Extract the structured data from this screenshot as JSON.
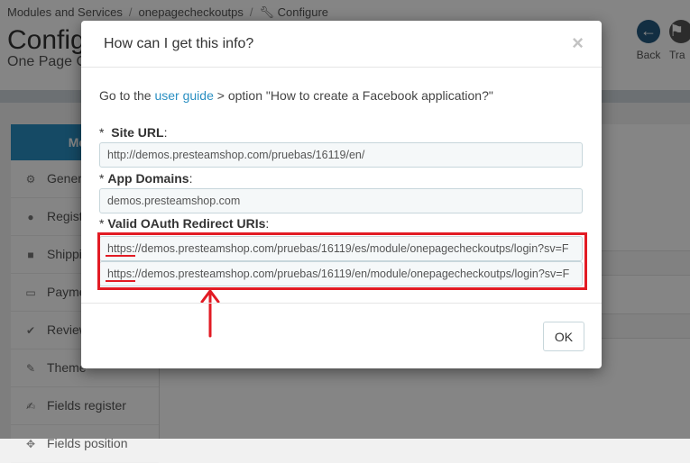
{
  "breadcrumb": [
    "Modules and Services",
    "onepagecheckoutps",
    "Configure"
  ],
  "page": {
    "title": "Configure",
    "subtitle": "One Page Checkout PS"
  },
  "toolbar": {
    "back_label": "Back",
    "translate_label": "Tra"
  },
  "sidebar": {
    "menu_label": "Menu",
    "items": [
      {
        "label": "General",
        "icon": "cogs-icon"
      },
      {
        "label": "Register",
        "icon": "user-icon"
      },
      {
        "label": "Shipping",
        "icon": "truck-icon"
      },
      {
        "label": "Payment",
        "icon": "credit-card-icon"
      },
      {
        "label": "Review",
        "icon": "check-icon"
      },
      {
        "label": "Theme",
        "icon": "brush-icon"
      },
      {
        "label": "Fields register",
        "icon": "edit-icon"
      },
      {
        "label": "Fields position",
        "icon": "move-icon"
      }
    ]
  },
  "modal": {
    "title": "How can I get this info?",
    "close_label": "×",
    "intro_prefix": "Go to the ",
    "intro_link": "user guide",
    "intro_suffix": " > option \"How to create a Facebook application?\"",
    "fields": {
      "site_url": {
        "asterisk": "*",
        "label": "Site URL",
        "colon": ":",
        "value": "http://demos.presteamshop.com/pruebas/16119/en/"
      },
      "app_domains": {
        "asterisk": "*",
        "label": "App Domains",
        "colon": ":",
        "value": "demos.presteamshop.com"
      },
      "redirect_uris": {
        "asterisk": "*",
        "label": "Valid OAuth Redirect URIs",
        "colon": ":",
        "values": [
          "https://demos.presteamshop.com/pruebas/16119/es/module/onepagecheckoutps/login?sv=F",
          "https://demos.presteamshop.com/pruebas/16119/en/module/onepagecheckoutps/login?sv=F"
        ]
      }
    },
    "ok_label": "OK"
  },
  "colors": {
    "annotation": "#e21b24",
    "link": "#2a8fc2",
    "accent": "#2a8fc2"
  }
}
